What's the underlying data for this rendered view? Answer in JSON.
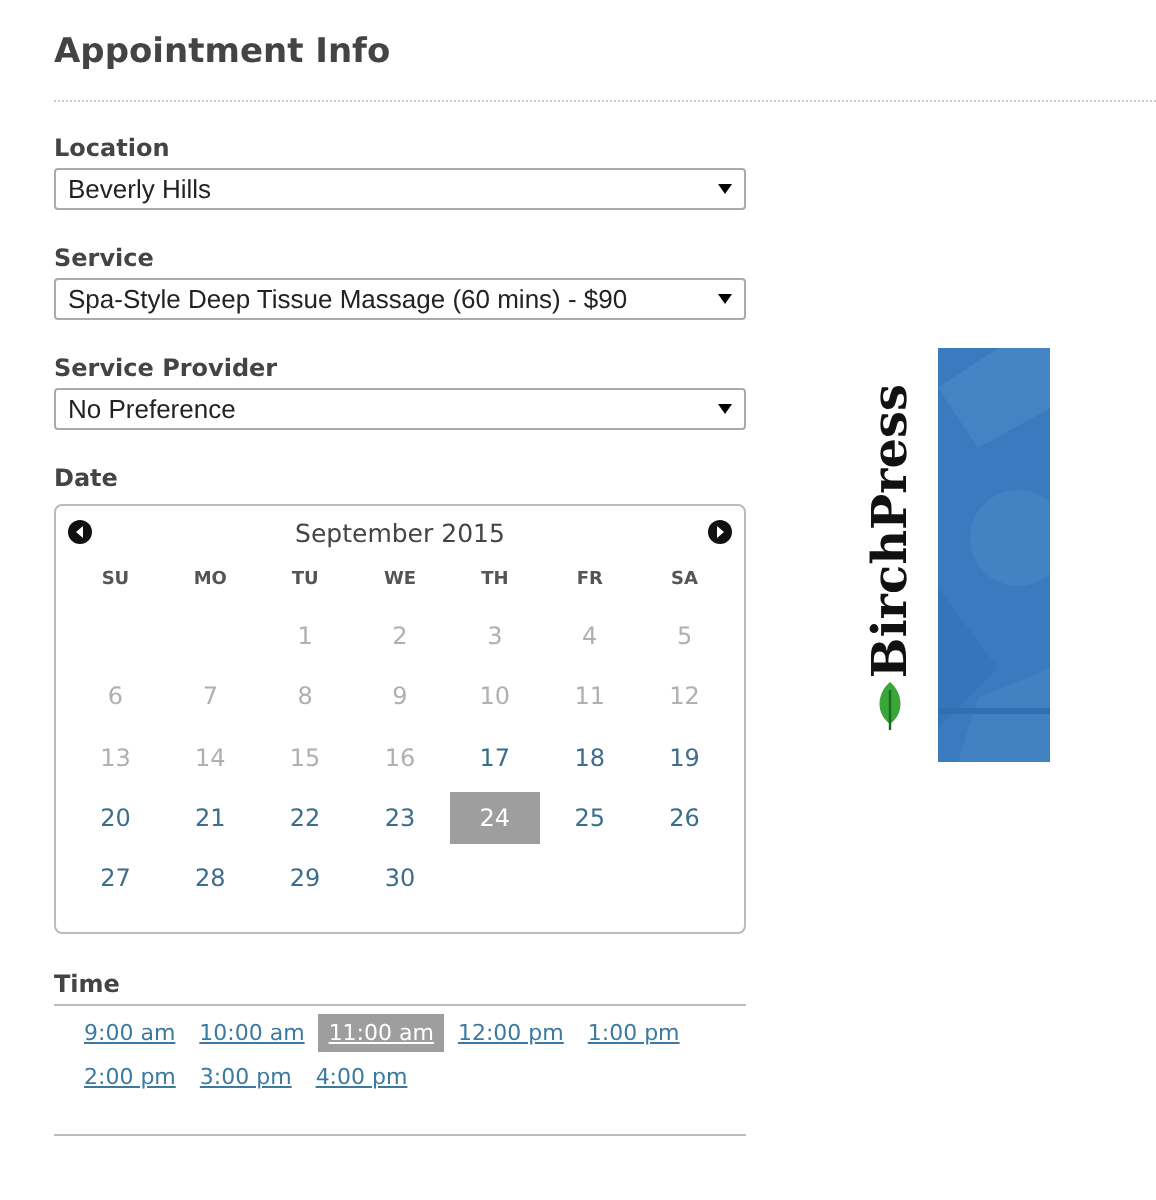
{
  "heading": "Appointment Info",
  "fields": [
    {
      "label": "Location",
      "value": "Beverly Hills"
    },
    {
      "label": "Service",
      "value": "Spa-Style Deep Tissue Massage (60 mins) - $90"
    },
    {
      "label": "Service Provider",
      "value": "No Preference"
    }
  ],
  "date": {
    "label": "Date",
    "month": "September 2015",
    "weekdays": [
      "SU",
      "MO",
      "TU",
      "WE",
      "TH",
      "FR",
      "SA"
    ],
    "weeks": [
      {
        "days": [
          {
            "day": "1",
            "disabled": true,
            "selected": false
          },
          {
            "day": "2",
            "disabled": true,
            "selected": false
          },
          {
            "day": "3",
            "disabled": true,
            "selected": false
          },
          {
            "day": "4",
            "disabled": true,
            "selected": false
          },
          {
            "day": "5",
            "disabled": true,
            "selected": false
          }
        ]
      },
      {
        "days": [
          {
            "day": "6",
            "disabled": true,
            "selected": false
          },
          {
            "day": "7",
            "disabled": true,
            "selected": false
          },
          {
            "day": "8",
            "disabled": true,
            "selected": false
          },
          {
            "day": "9",
            "disabled": true,
            "selected": false
          },
          {
            "day": "10",
            "disabled": true,
            "selected": false
          },
          {
            "day": "11",
            "disabled": true,
            "selected": false
          },
          {
            "day": "12",
            "disabled": true,
            "selected": false
          }
        ]
      },
      {
        "days": [
          {
            "day": "13",
            "disabled": true,
            "selected": false
          },
          {
            "day": "14",
            "disabled": true,
            "selected": false
          },
          {
            "day": "15",
            "disabled": true,
            "selected": false
          },
          {
            "day": "16",
            "disabled": true,
            "selected": false
          },
          {
            "day": "17",
            "disabled": false,
            "selected": false
          },
          {
            "day": "18",
            "disabled": false,
            "selected": false
          },
          {
            "day": "19",
            "disabled": false,
            "selected": false
          }
        ]
      },
      {
        "days": [
          {
            "day": "20",
            "disabled": false,
            "selected": false
          },
          {
            "day": "21",
            "disabled": false,
            "selected": false
          },
          {
            "day": "22",
            "disabled": false,
            "selected": false
          },
          {
            "day": "23",
            "disabled": false,
            "selected": false
          },
          {
            "day": "24",
            "disabled": false,
            "selected": true
          },
          {
            "day": "25",
            "disabled": false,
            "selected": false
          },
          {
            "day": "26",
            "disabled": false,
            "selected": false
          }
        ]
      },
      {
        "days": [
          {
            "day": "27",
            "disabled": false,
            "selected": false
          },
          {
            "day": "28",
            "disabled": false,
            "selected": false
          },
          {
            "day": "29",
            "disabled": false,
            "selected": false
          },
          {
            "day": "30",
            "disabled": false,
            "selected": false
          }
        ]
      }
    ]
  },
  "time": {
    "label": "Time",
    "slots": [
      {
        "label": "9:00 am",
        "selected": false
      },
      {
        "label": "10:00 am",
        "selected": false
      },
      {
        "label": "11:00 am",
        "selected": true
      },
      {
        "label": "12:00 pm",
        "selected": false
      },
      {
        "label": "1:00 pm",
        "selected": false
      },
      {
        "label": "2:00 pm",
        "selected": false
      },
      {
        "label": "3:00 pm",
        "selected": false
      },
      {
        "label": "4:00 pm",
        "selected": false
      }
    ]
  },
  "banner": {
    "logo": "BirchPress"
  }
}
